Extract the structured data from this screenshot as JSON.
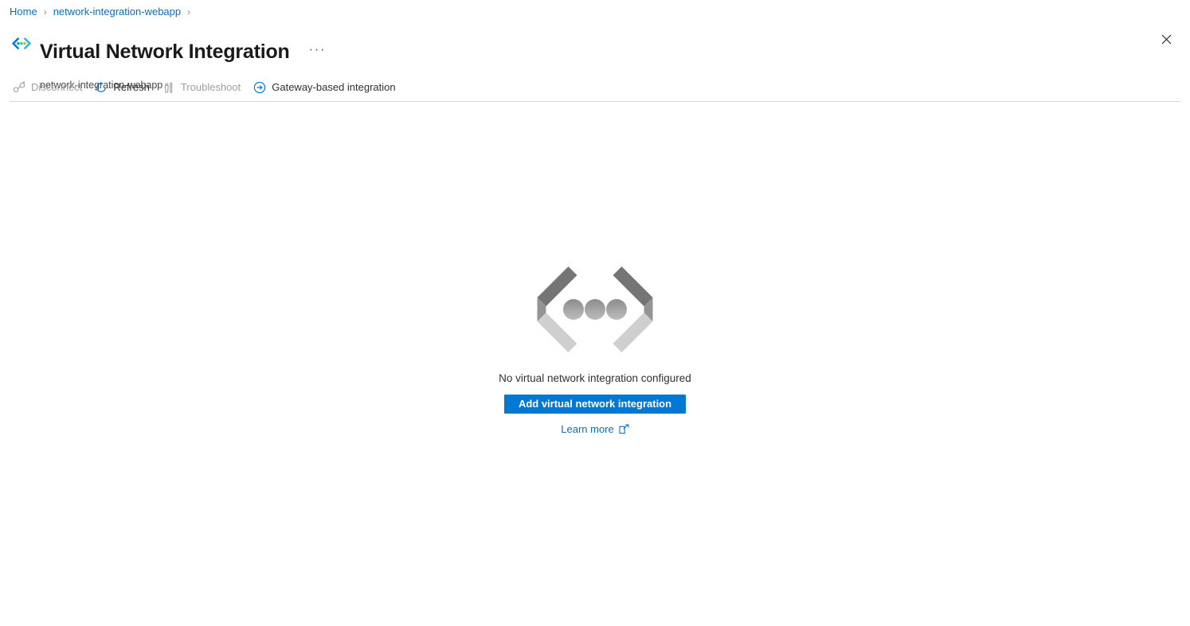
{
  "breadcrumb": {
    "items": [
      {
        "label": "Home"
      },
      {
        "label": "network-integration-webapp"
      }
    ],
    "separator": "›"
  },
  "header": {
    "icon": "vnet-integration-icon",
    "title": "Virtual Network Integration",
    "subtitle": "network-integration-webapp",
    "more_label": "···",
    "close_icon": "close-icon"
  },
  "commandbar": {
    "items": [
      {
        "label": "Disconnect",
        "icon": "disconnect-icon",
        "disabled": true
      },
      {
        "label": "Refresh",
        "icon": "refresh-icon",
        "disabled": false
      },
      {
        "label": "Troubleshoot",
        "icon": "troubleshoot-icon",
        "disabled": true
      },
      {
        "label": "Gateway-based integration",
        "icon": "arrow-circle-right-icon",
        "disabled": false
      }
    ]
  },
  "empty_state": {
    "graphic_icon": "vnet-integration-graphic",
    "message": "No virtual network integration configured",
    "primary_button": "Add virtual network integration",
    "learn_more": "Learn more",
    "learn_more_icon": "external-link-icon"
  },
  "colors": {
    "accent": "#0078d4",
    "link": "#0f6cbd",
    "text": "#323130",
    "disabled": "#a19f9d",
    "divider": "#d6d6d6"
  }
}
